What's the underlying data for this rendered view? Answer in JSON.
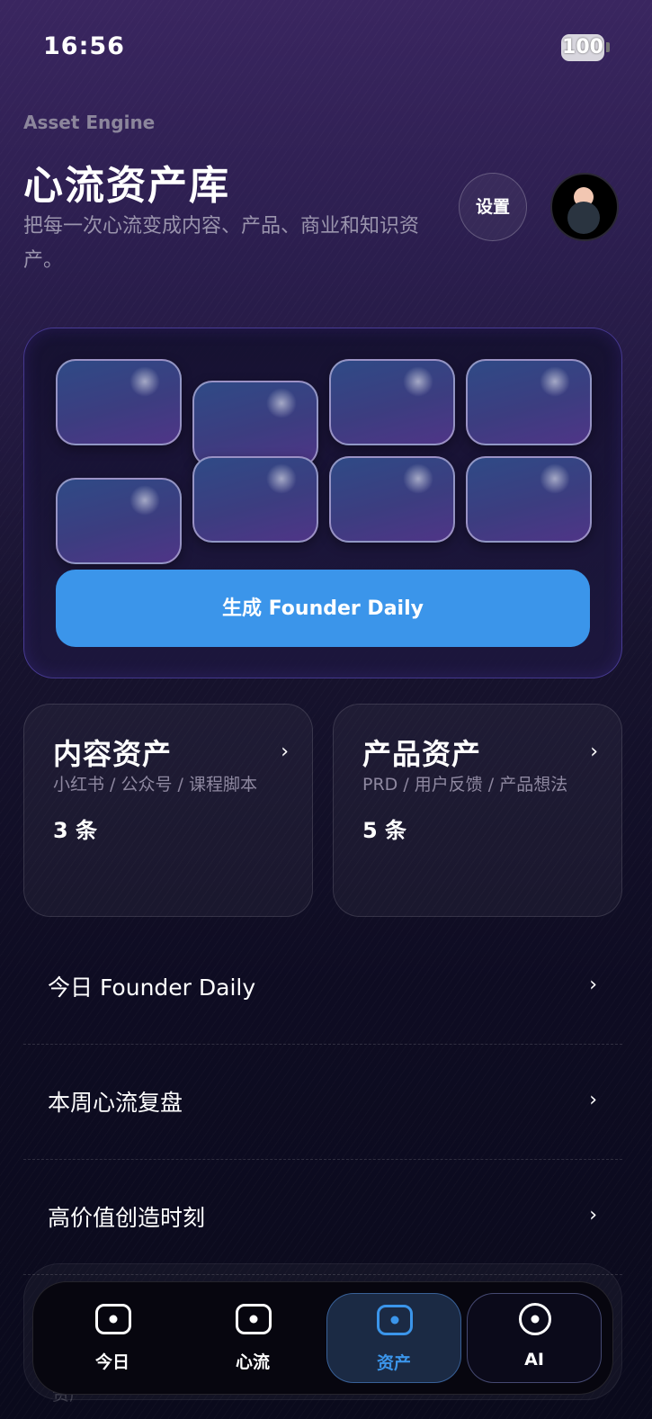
{
  "status_bar": {
    "time": "16:56",
    "battery": "100"
  },
  "header": {
    "eyebrow": "Asset Engine",
    "title": "心流资产库",
    "subtitle": "把每一次心流变成内容、产品、商业和知识资产。",
    "settings_label": "设置",
    "avatar_icon": "user-avatar-icon"
  },
  "hero": {
    "tile_count": 8,
    "cta_label": "生成 Founder Daily"
  },
  "asset_cards": [
    {
      "title": "内容资产",
      "desc": "小红书 / 公众号 / 课程脚本",
      "count": "3 条"
    },
    {
      "title": "产品资产",
      "desc": "PRD / 用户反馈 / 产品想法",
      "count": "5 条"
    }
  ],
  "list": [
    {
      "label": "今日 Founder Daily"
    },
    {
      "label": "本周心流复盘"
    },
    {
      "label": "高价值创造时刻"
    }
  ],
  "list_partial_label": "资产",
  "chevron": "›",
  "tabs": [
    {
      "label": "今日",
      "icon": "screen-icon",
      "active": false
    },
    {
      "label": "心流",
      "icon": "screen-icon",
      "active": false
    },
    {
      "label": "资产",
      "icon": "screen-icon",
      "active": true
    },
    {
      "label": "AI",
      "icon": "circle-dot-icon",
      "active": false
    }
  ],
  "colors": {
    "accent": "#3b95ea",
    "background_top": "#3a2660",
    "background_bottom": "#0a0a1c"
  }
}
